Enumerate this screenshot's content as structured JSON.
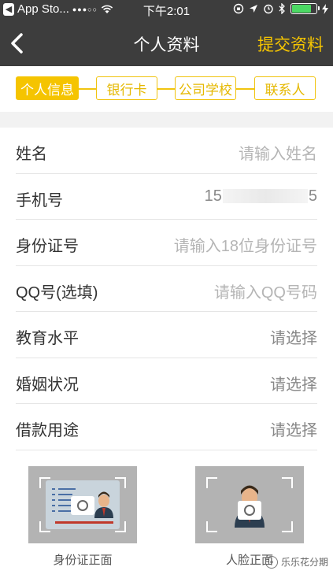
{
  "status_bar": {
    "back_app": "App Sto...",
    "signal": "●●●○○",
    "time": "下午2:01",
    "battery_level": 0.8,
    "battery_color": "#4cd964"
  },
  "nav": {
    "title": "个人资料",
    "submit_label": "提交资料",
    "back_icon": "chevron-left-icon"
  },
  "steps": [
    {
      "label": "个人信息",
      "active": true
    },
    {
      "label": "银行卡",
      "active": false
    },
    {
      "label": "公司学校",
      "active": false
    },
    {
      "label": "联系人",
      "active": false
    }
  ],
  "form": {
    "rows": [
      {
        "label": "姓名",
        "value": "请输入姓名",
        "is_placeholder": true
      },
      {
        "label": "手机号",
        "value_prefix": "15",
        "value_suffix": "5",
        "is_placeholder": false
      },
      {
        "label": "身份证号",
        "value": "请输入18位身份证号",
        "is_placeholder": true
      },
      {
        "label": "QQ号(选填)",
        "value": "请输入QQ号码",
        "is_placeholder": true
      },
      {
        "label": "教育水平",
        "value": "请选择",
        "is_placeholder": false
      },
      {
        "label": "婚姻状况",
        "value": "请选择",
        "is_placeholder": false
      },
      {
        "label": "借款用途",
        "value": "请选择",
        "is_placeholder": false
      }
    ]
  },
  "photos": {
    "id_front_caption": "身份证正面",
    "face_front_caption": "人脸正面"
  },
  "watermark": "乐乐花分期",
  "colors": {
    "accent": "#f5c400",
    "nav_bg": "#3d3d3d",
    "placeholder": "#b5b5b5"
  }
}
